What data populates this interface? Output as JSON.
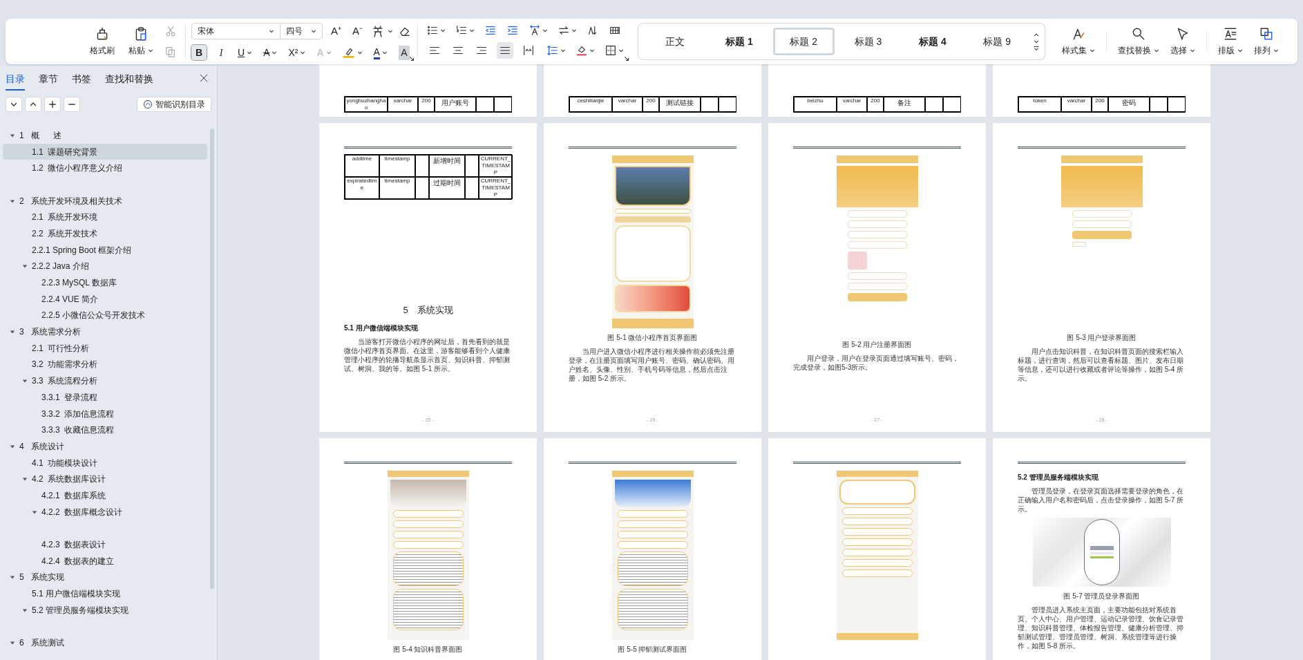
{
  "ribbon": {
    "clipboard": [
      {
        "kind": "format_painter",
        "label": "格式刷",
        "dropdown": false
      },
      {
        "kind": "paste",
        "label": "粘贴",
        "dropdown": true
      }
    ],
    "font": {
      "name": "宋体",
      "size": "四号"
    },
    "font_tools": [
      {
        "label": "A⁺"
      },
      {
        "label": "A⁻"
      }
    ],
    "format_buttons": [
      {
        "kind": "bold",
        "label": "B",
        "selected": true,
        "dropdown": false,
        "disabled": false
      },
      {
        "kind": "italic",
        "label": "I",
        "selected": false,
        "dropdown": false,
        "disabled": false
      },
      {
        "kind": "underline",
        "label": "U",
        "selected": false,
        "dropdown": true,
        "disabled": false
      },
      {
        "kind": "strike",
        "label": "A",
        "selected": false,
        "dropdown": true,
        "disabled": false
      },
      {
        "kind": "superscript",
        "label": "X²",
        "selected": false,
        "dropdown": true,
        "disabled": false
      },
      {
        "kind": "effect",
        "label": "A",
        "selected": false,
        "dropdown": true,
        "disabled": true
      },
      {
        "kind": "highlight",
        "selected": false,
        "dropdown": true,
        "disabled": false
      },
      {
        "kind": "color",
        "label": "A",
        "selected": false,
        "dropdown": true,
        "disabled": false
      },
      {
        "kind": "shade",
        "label": "A",
        "selected": false,
        "dropdown": false,
        "disabled": false
      }
    ],
    "align_buttons": [
      {
        "kind": "left",
        "selected": false
      },
      {
        "kind": "center",
        "selected": false
      },
      {
        "kind": "right",
        "selected": false
      },
      {
        "kind": "justify",
        "selected": true
      },
      {
        "kind": "distributed",
        "selected": false
      }
    ],
    "styles": [
      {
        "label": "正文",
        "selected": false,
        "bold": false
      },
      {
        "label": "标题 1",
        "selected": false,
        "bold": true
      },
      {
        "label": "标题 2",
        "selected": true,
        "bold": false
      },
      {
        "label": "标题 3",
        "selected": false,
        "bold": false
      },
      {
        "label": "标题 4",
        "selected": false,
        "bold": true
      },
      {
        "label": "标题 9",
        "selected": false,
        "bold": false
      }
    ],
    "tools": [
      {
        "kind": "styles",
        "label": "样式集"
      },
      {
        "kind": "find",
        "label": "查找替换"
      },
      {
        "kind": "select",
        "label": "选择"
      },
      {
        "kind": "layout",
        "label": "排版"
      },
      {
        "kind": "arrange",
        "label": "排列"
      }
    ]
  },
  "sidebar": {
    "tabs": [
      {
        "label": "目录",
        "selected": true
      },
      {
        "label": "章节",
        "selected": false
      },
      {
        "label": "书签",
        "selected": false
      },
      {
        "label": "查找和替换",
        "selected": false
      }
    ],
    "smart_button": "智能识别目录",
    "toc": [
      {
        "label": "1   概      述",
        "expanded": true,
        "selected": false,
        "children": [
          {
            "label": "1.1  课题研究背景",
            "selected": true
          },
          {
            "label": "1.2  微信小程序意义介绍",
            "selected": false
          }
        ]
      },
      {
        "label": "2   系统开发环境及相关技术",
        "expanded": true,
        "selected": false,
        "children": [
          {
            "label": "2.1  系统开发环境",
            "selected": false
          },
          {
            "label": "2.2  系统开发技术",
            "selected": false
          },
          {
            "label": "2.2.1 Spring Boot 框架介绍",
            "selected": false
          },
          {
            "label": "2.2.2 Java 介绍",
            "expanded": true,
            "selected": false,
            "children": [
              {
                "label": "2.2.3 MySQL 数据库",
                "selected": false
              },
              {
                "label": "2.2.4 VUE 简介",
                "selected": false
              },
              {
                "label": "2.2.5 小微信公众号开发技术",
                "selected": false
              }
            ]
          }
        ]
      },
      {
        "label": "3   系统需求分析",
        "expanded": true,
        "selected": false,
        "children": [
          {
            "label": "2.1  可行性分析",
            "selected": false
          },
          {
            "label": "3.2  功能需求分析",
            "selected": false
          },
          {
            "label": "3.3  系统流程分析",
            "expanded": true,
            "selected": false,
            "children": [
              {
                "label": "3.3.1  登录流程",
                "selected": false
              },
              {
                "label": "3.3.2  添加信息流程",
                "selected": false
              },
              {
                "label": "3.3.3  收藏信息流程",
                "selected": false
              }
            ]
          }
        ]
      },
      {
        "label": "4   系统设计",
        "expanded": true,
        "selected": false,
        "children": [
          {
            "label": "4.1  功能模块设计",
            "selected": false
          },
          {
            "label": "4.2  系统数据库设计",
            "expanded": true,
            "selected": false,
            "children": [
              {
                "label": "4.2.1  数据库系统",
                "selected": false
              },
              {
                "label": "4.2.2  数据库概念设计",
                "expanded": true,
                "selected": false
              },
              {
                "label": "4.2.3  数据表设计",
                "selected": false
              },
              {
                "label": "4.2.4  数据表的建立",
                "selected": false
              }
            ]
          }
        ]
      },
      {
        "label": "5   系统实现",
        "expanded": true,
        "selected": false,
        "children": [
          {
            "label": "5.1 用户微信端模块实现",
            "selected": false
          },
          {
            "label": "5.2 管理员服务端模块实现",
            "expanded": true,
            "selected": false
          }
        ]
      },
      {
        "label": "6   系统测试",
        "expanded": true,
        "selected": false
      }
    ]
  },
  "pages": [
    {
      "blocks": [
        {
          "kind": "table",
          "rows": [
            {
              "column_1": "yonghuzhanghao",
              "column_2": "varchar",
              "column_3": "200",
              "column_4": "用户账号"
            }
          ]
        }
      ]
    },
    {
      "blocks": [
        {
          "kind": "table",
          "rows": [
            {
              "column_1": "ceshilianjie",
              "column_2": "varchar",
              "column_3": "200",
              "column_4": "测试链接"
            }
          ]
        }
      ]
    },
    {
      "blocks": [
        {
          "kind": "table",
          "rows": [
            {
              "column_1": "beizhu",
              "column_2": "varchar",
              "column_3": "200",
              "column_4": "备注"
            }
          ]
        }
      ]
    },
    {
      "blocks": [
        {
          "kind": "table",
          "rows": [
            {
              "column_1": "token",
              "column_2": "varchar",
              "column_3": "200",
              "column_4": "密码"
            }
          ]
        }
      ]
    },
    {
      "page_number": "- 25 -",
      "blocks": [
        {
          "kind": "table",
          "rows": [
            {
              "column_1": "addtime",
              "column_2": "timestamp",
              "column_4": "新增时间",
              "column_6": "CURRENT_TIMESTAMP"
            },
            {
              "column_1": "expiratedtime",
              "column_2": "timestamp",
              "column_4": "过期时间",
              "column_6": "CURRENT_TIMESTAMP"
            }
          ]
        },
        {
          "kind": "chapter",
          "text": "5　系统实现"
        },
        {
          "kind": "heading",
          "text": "5.1 用户微信端模块实现"
        },
        {
          "kind": "paragraph",
          "text": "当游客打开微信小程序的网址后，首先看到的就是微信小程序首页界面。在这里，游客能够看到个人健康管理小程序的轮播导航条显示首页、知识科普、抑郁测试、树洞、我的等。如图 5-1 所示。"
        }
      ]
    },
    {
      "page_number": "- 26 -",
      "blocks": [
        {
          "kind": "home_screen"
        },
        {
          "kind": "caption",
          "text": "图 5-1 微信小程序首页界面图"
        },
        {
          "kind": "paragraph",
          "text": "当用户进入微信小程序进行相关操作前必须先注册登录，在注册页面填写用户账号、密码、确认密码、用户姓名、头像、性别、手机号码等信息，然后点击注册，如图 5-2 所示。"
        }
      ]
    },
    {
      "page_number": "- 27 -",
      "blocks": [
        {
          "kind": "register_screen"
        },
        {
          "kind": "caption",
          "text": "图 5-2 用户注册界面图"
        },
        {
          "kind": "paragraph",
          "text": "用户登录，用户在登录页面通过填写账号、密码，完成登录，如图5-3所示。"
        }
      ]
    },
    {
      "page_number": "- 28 -",
      "blocks": [
        {
          "kind": "login_screen"
        },
        {
          "kind": "caption",
          "text": "图 5-3 用户登录界面图"
        },
        {
          "kind": "paragraph",
          "text": "用户点击知识科普，在知识科普页面的搜索栏输入标题，进行查询，然后可以查看标题、图片、发布日期等信息，还可以进行收藏或者评论等操作，如图 5-4 所示。"
        }
      ]
    },
    {
      "blocks": [
        {
          "kind": "article_screen"
        },
        {
          "kind": "caption",
          "text": "图 5-4 知识科普界面图"
        }
      ]
    },
    {
      "blocks": [
        {
          "kind": "test_screen"
        },
        {
          "kind": "caption",
          "text": "图 5-5 抑郁测试界面图"
        }
      ]
    },
    {
      "blocks": [
        {
          "kind": "profile_screen"
        }
      ]
    },
    {
      "blocks": [
        {
          "kind": "heading",
          "text": "5.2 管理员服务端模块实现"
        },
        {
          "kind": "paragraph",
          "text": "管理员登录，在登录页面选择需要登录的角色，在正确输入用户名和密码后，点击登录操作，如图 5-7 所示。"
        },
        {
          "kind": "admin_login_screen"
        },
        {
          "kind": "caption",
          "text": "图 5-7 管理员登录界面图"
        },
        {
          "kind": "paragraph",
          "text": "管理员进入系统主页面，主要功能包括对系统首页、个人中心、用户管理、运动记录管理、饮食记录管理、知识科普管理、体检报告管理、健康分析管理、抑郁测试管理、管理员管理、树洞、系统管理等进行操作，如图 5-8 所示。"
        }
      ]
    }
  ]
}
